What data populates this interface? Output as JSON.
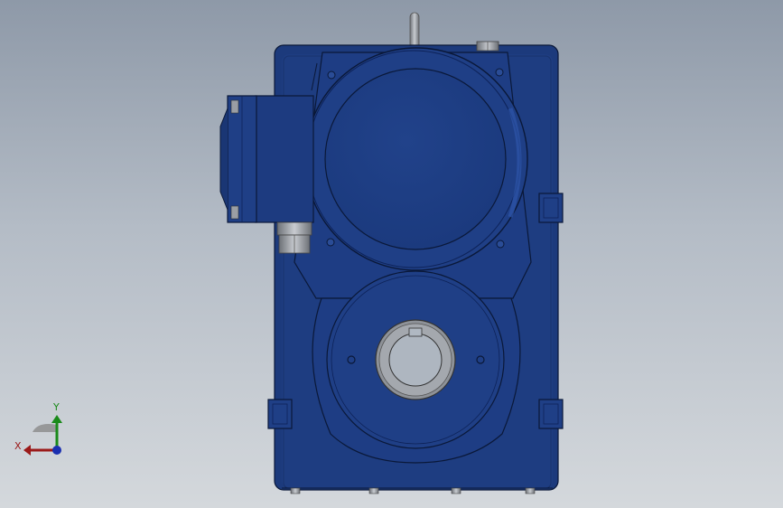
{
  "viewport": {
    "background_top": "#8e99a8",
    "background_bottom": "#d4d8dc"
  },
  "model": {
    "body_color": "#1f3f86",
    "body_shade": "#18326e",
    "body_highlight": "#2c55a8",
    "edge_color": "#0a1838",
    "steel_color": "#9a9ea4"
  },
  "triad": {
    "x_label": "X",
    "y_label": "Y",
    "x_color": "#9b1a1a",
    "y_color": "#1a8a1a",
    "z_color": "#1a2fb0"
  }
}
